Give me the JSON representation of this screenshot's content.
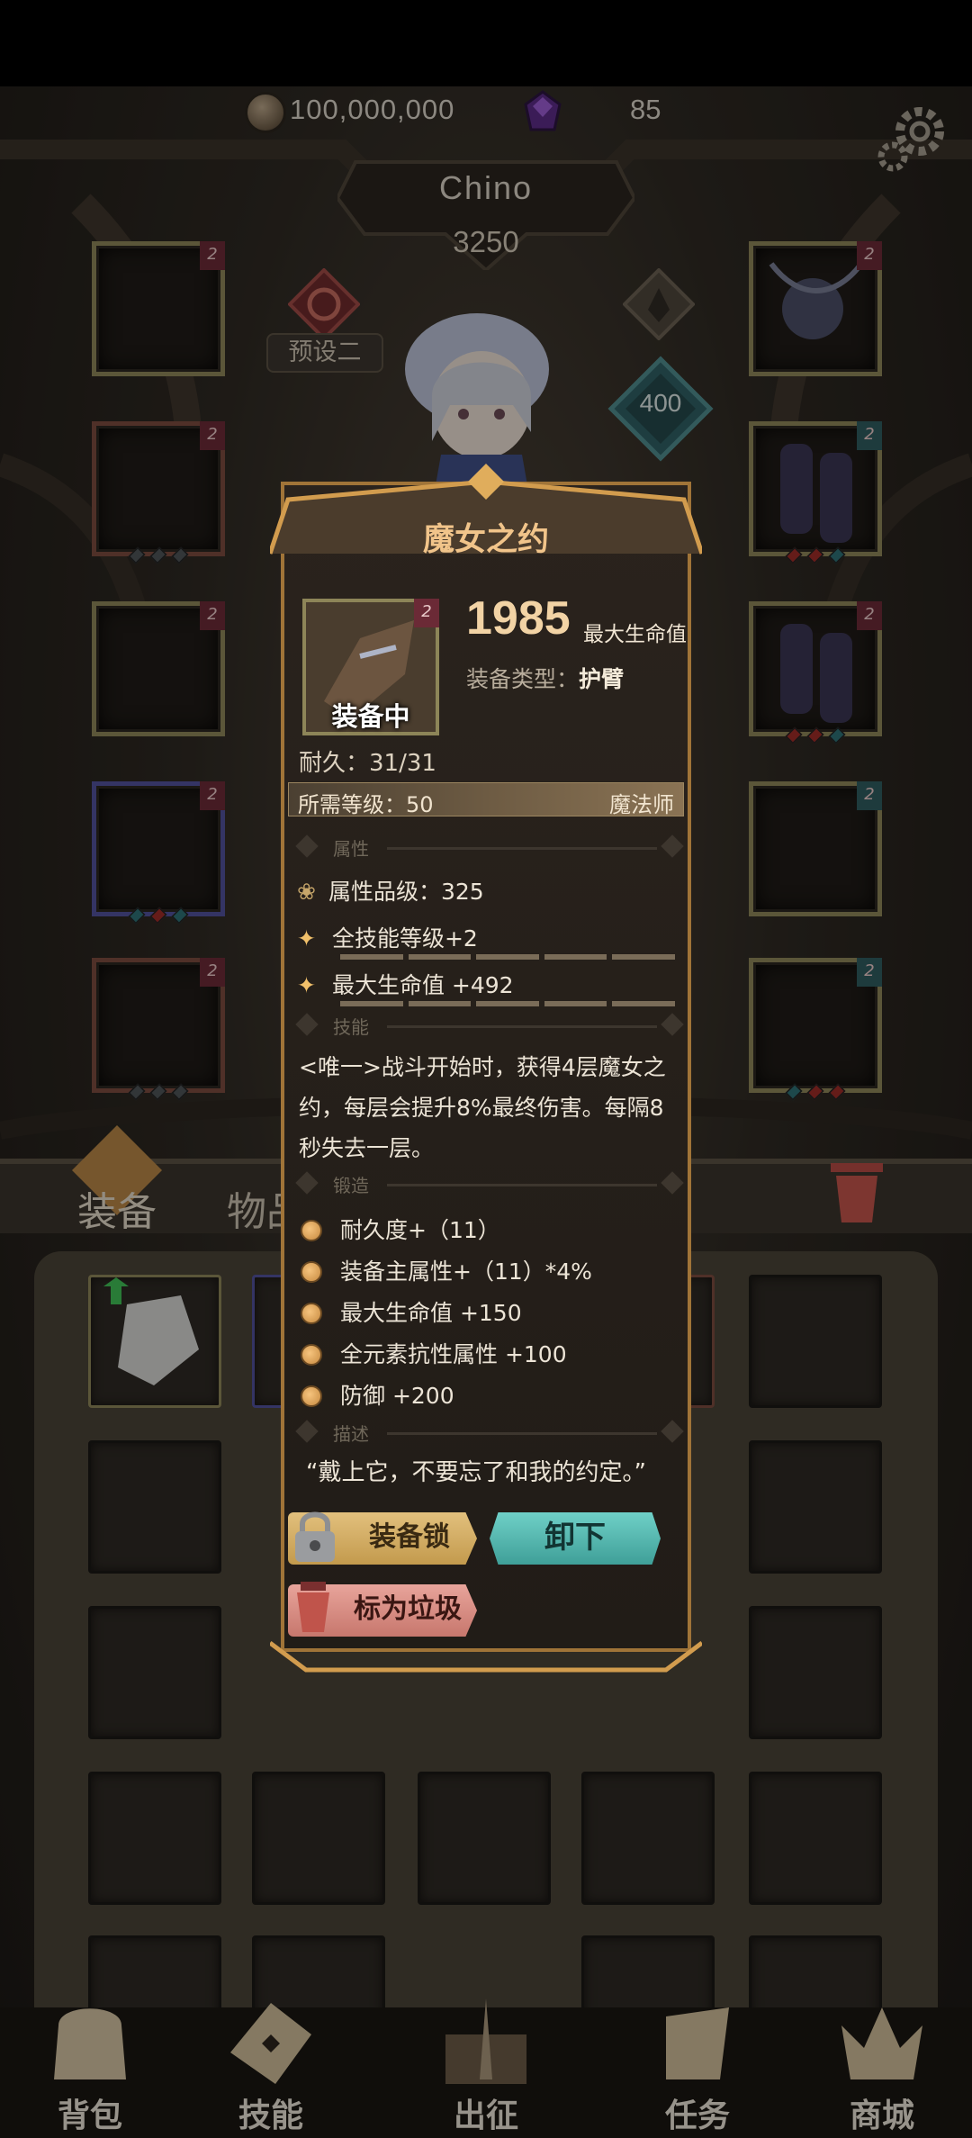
{
  "currency": {
    "gold": "100,000,000",
    "gems": "85"
  },
  "player": {
    "name": "Chino",
    "power": "3250",
    "preset": "预设二",
    "level": "400"
  },
  "tabs": {
    "equipment": "装备",
    "items": "物品"
  },
  "nav": [
    {
      "label": "背包"
    },
    {
      "label": "技能"
    },
    {
      "label": "出征"
    },
    {
      "label": "任务"
    },
    {
      "label": "商城"
    }
  ],
  "item": {
    "name": "魔女之约",
    "main_value": "1985",
    "main_stat": "最大生命值",
    "type_label": "装备类型：",
    "type_value": "护臂",
    "equipped": "装备中",
    "durability": "耐久：31/31",
    "required_level": "所需等级：50",
    "class": "魔法师",
    "sections": {
      "attributes": "属性",
      "skill": "技能",
      "forge": "锻造",
      "description": "描述"
    },
    "attribute_grade": "属性品级：325",
    "attributes": [
      "全技能等级+2",
      "最大生命值 +492"
    ],
    "skill": "<唯一>战斗开始时，获得4层魔女之约，每层会提升8%最终伤害。每隔8秒失去一层。",
    "forge": [
      "耐久度+（11）",
      "装备主属性+（11）*4%",
      "最大生命值 +150",
      "全元素抗性属性 +100",
      "防御 +200"
    ],
    "description": "“戴上它，不要忘了和我的约定。”",
    "tag": "2"
  },
  "buttons": {
    "lock": "装备锁",
    "unequip": "卸下",
    "mark_junk": "标为垃圾"
  },
  "colors": {
    "accent_gold": "#f1c48a",
    "teal": "#3f9f98",
    "frame": "#a07438"
  }
}
